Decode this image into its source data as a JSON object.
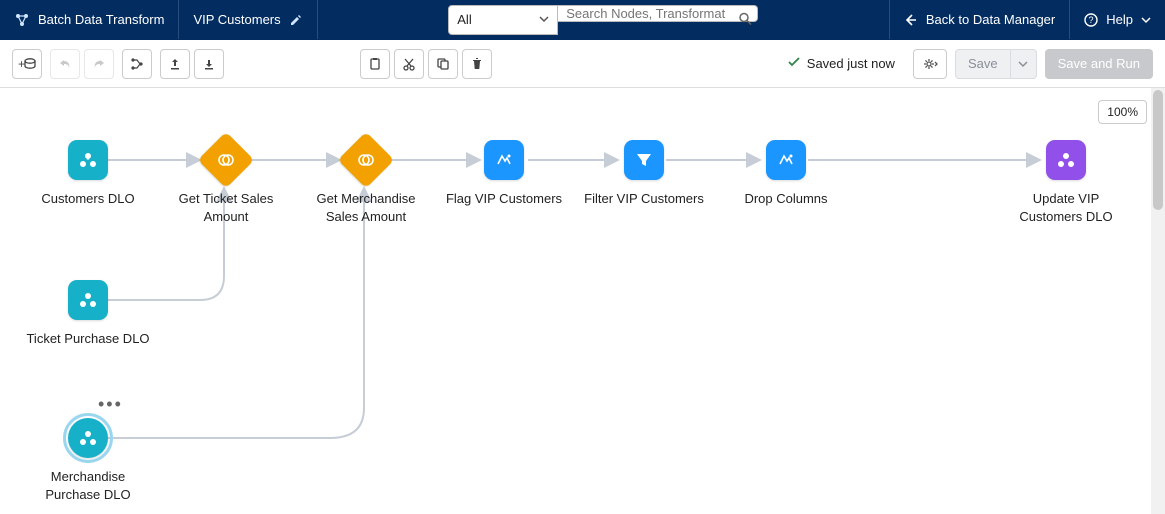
{
  "header": {
    "app_title": "Batch Data Transform",
    "flow_name": "VIP Customers",
    "back_label": "Back to Data Manager",
    "help_label": "Help"
  },
  "search": {
    "filter_selected": "All",
    "placeholder": "Search Nodes, Transformat"
  },
  "toolbar": {
    "status_text": "Saved just now",
    "save_label": "Save",
    "save_run_label": "Save and Run"
  },
  "canvas": {
    "zoom": "100%"
  },
  "nodes": {
    "customers_dlo": "Customers DLO",
    "ticket_purchase_dlo": "Ticket Purchase DLO",
    "merch_purchase_dlo": "Merchandise Purchase DLO",
    "get_ticket_amount": "Get Ticket Sales Amount",
    "get_merch_amount": "Get Merchandise Sales Amount",
    "flag_vip": "Flag VIP Customers",
    "filter_vip": "Filter VIP Customers",
    "drop_cols": "Drop Columns",
    "update_vip": "Update VIP Customers DLO"
  }
}
